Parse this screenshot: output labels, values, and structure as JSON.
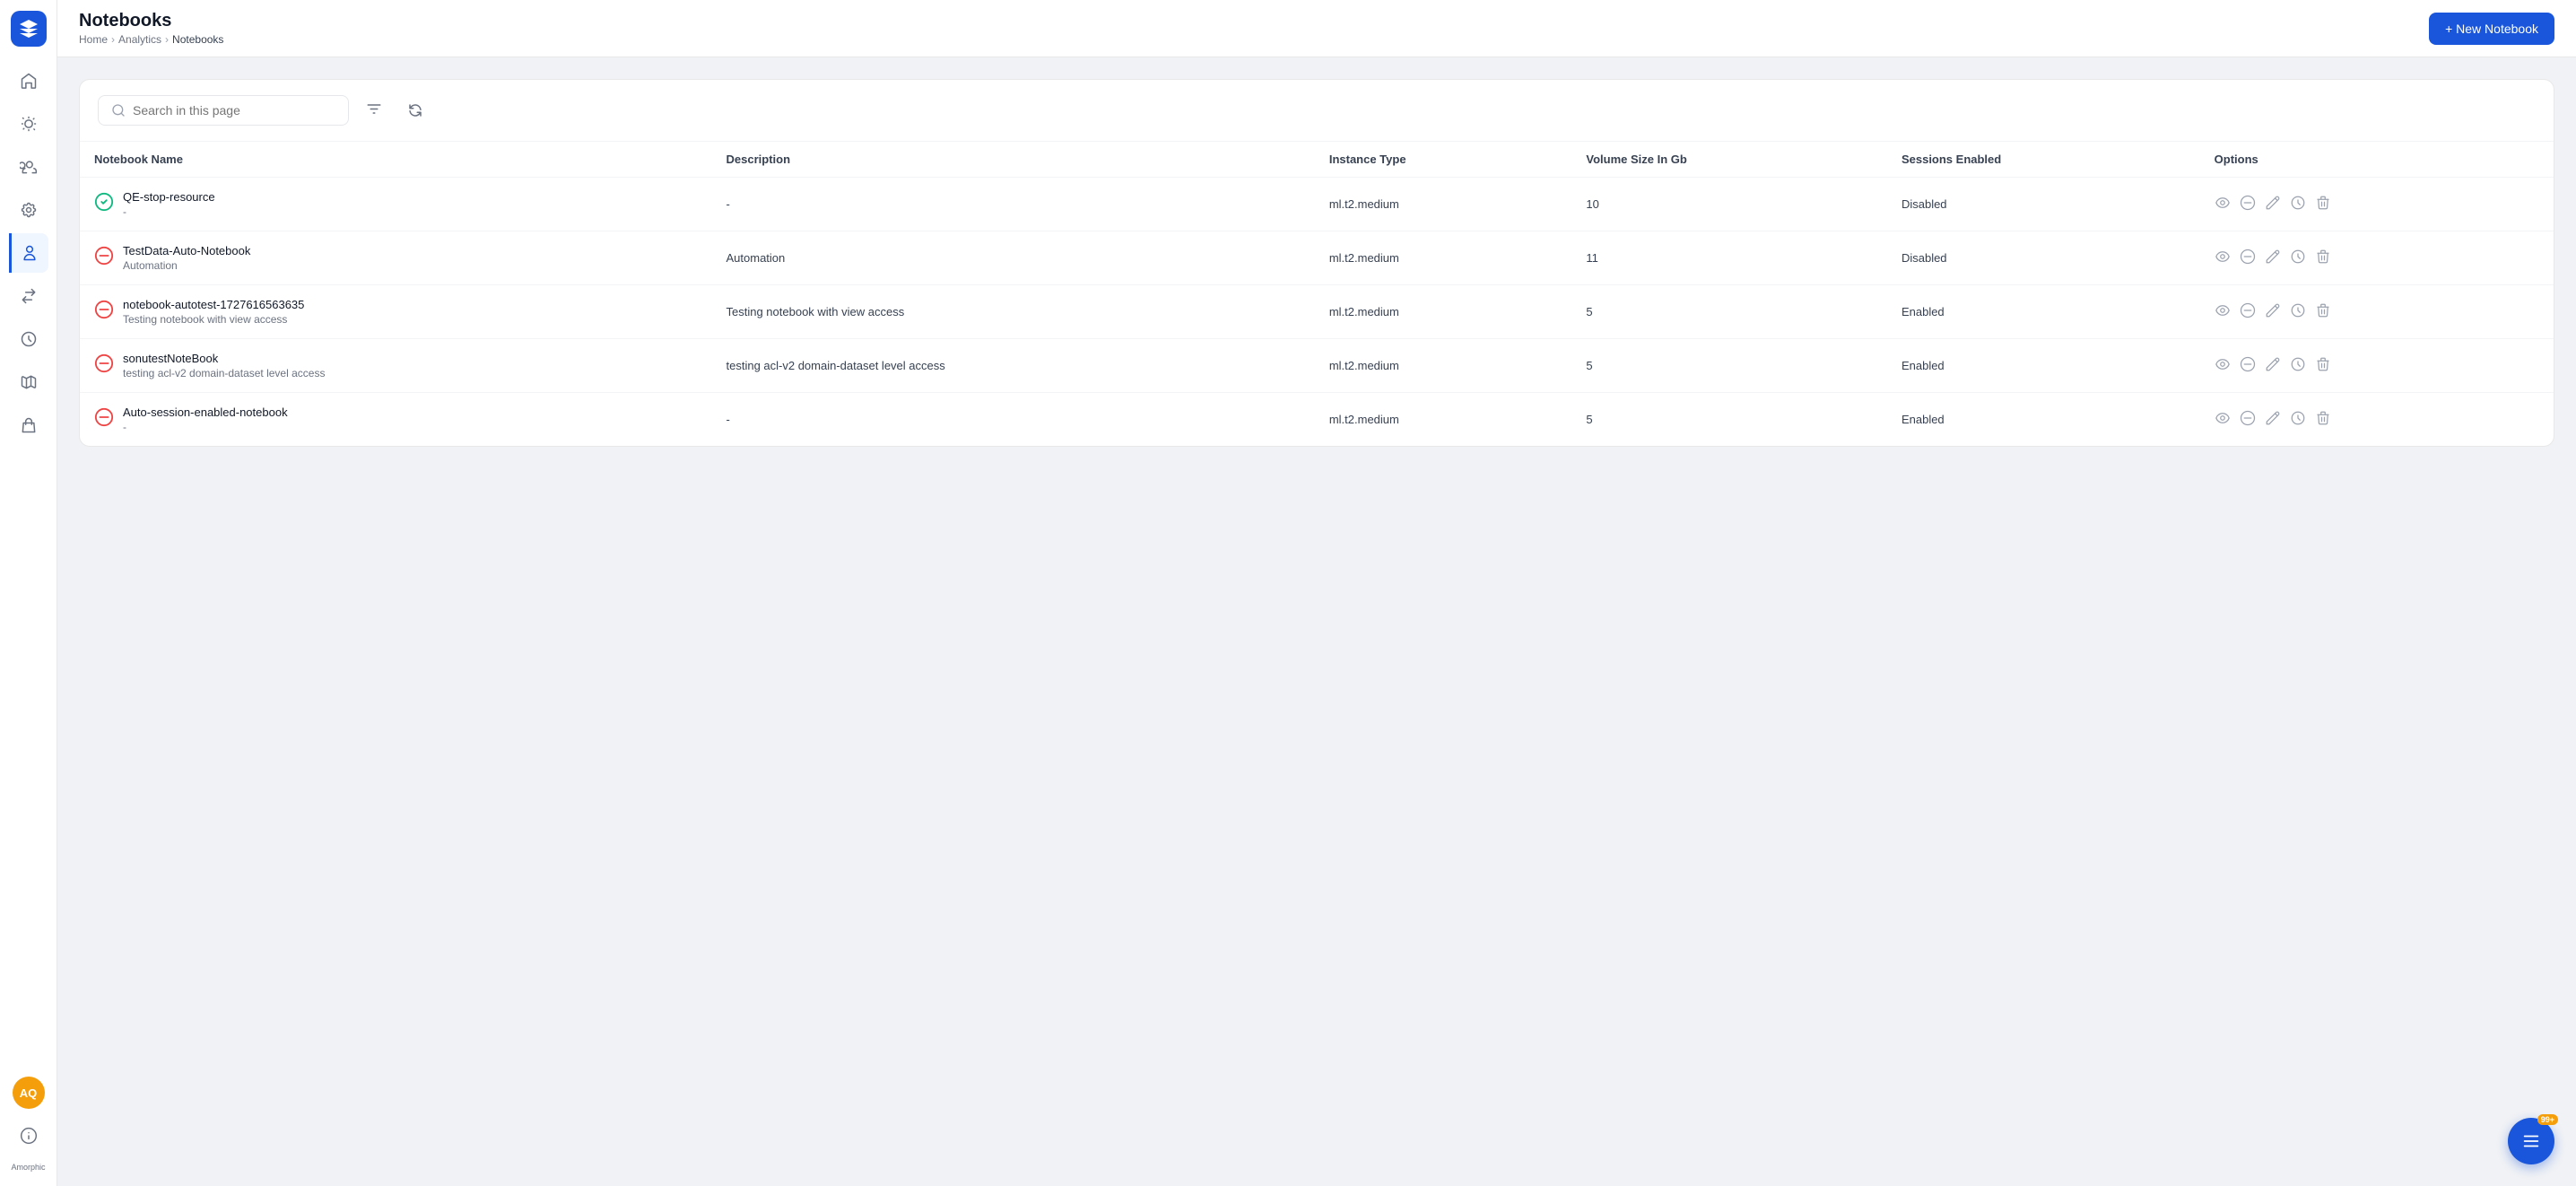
{
  "app": {
    "name": "Amorphic",
    "logo_alt": "Amorphic logo"
  },
  "header": {
    "title": "Notebooks",
    "breadcrumb": [
      "Home",
      "Analytics",
      "Notebooks"
    ],
    "new_notebook_btn": "+ New Notebook"
  },
  "toolbar": {
    "search_placeholder": "Search in this page"
  },
  "table": {
    "columns": [
      "Notebook Name",
      "Description",
      "Instance Type",
      "Volume Size In Gb",
      "Sessions Enabled",
      "Options"
    ],
    "rows": [
      {
        "status": "running",
        "name": "QE-stop-resource",
        "sub": "-",
        "description": "-",
        "instance_type": "ml.t2.medium",
        "volume_size": "10",
        "sessions_enabled": "Disabled"
      },
      {
        "status": "stopped",
        "name": "TestData-Auto-Notebook",
        "sub": "Automation",
        "description": "Automation",
        "instance_type": "ml.t2.medium",
        "volume_size": "11",
        "sessions_enabled": "Disabled"
      },
      {
        "status": "stopped",
        "name": "notebook-autotest-1727616563635",
        "sub": "Testing notebook with view access",
        "description": "Testing notebook with view access",
        "instance_type": "ml.t2.medium",
        "volume_size": "5",
        "sessions_enabled": "Enabled"
      },
      {
        "status": "stopped",
        "name": "sonutestNoteBook",
        "sub": "testing acl-v2 domain-dataset level access",
        "description": "testing acl-v2 domain-dataset level access",
        "instance_type": "ml.t2.medium",
        "volume_size": "5",
        "sessions_enabled": "Enabled"
      },
      {
        "status": "stopped",
        "name": "Auto-session-enabled-notebook",
        "sub": "-",
        "description": "-",
        "instance_type": "ml.t2.medium",
        "volume_size": "5",
        "sessions_enabled": "Enabled"
      }
    ]
  },
  "sidebar": {
    "items": [
      {
        "name": "home",
        "label": "Home"
      },
      {
        "name": "pipeline",
        "label": "Pipeline"
      },
      {
        "name": "users",
        "label": "Users"
      },
      {
        "name": "settings",
        "label": "Settings"
      },
      {
        "name": "profile",
        "label": "Profile"
      },
      {
        "name": "connections",
        "label": "Connections"
      },
      {
        "name": "history",
        "label": "History"
      },
      {
        "name": "map",
        "label": "Map"
      },
      {
        "name": "storage",
        "label": "Storage"
      }
    ],
    "active": "profile",
    "bottom": {
      "avatar_initials": "AQ",
      "info_label": "Info",
      "app_name": "Amorphic"
    }
  },
  "fab": {
    "badge": "99+"
  }
}
